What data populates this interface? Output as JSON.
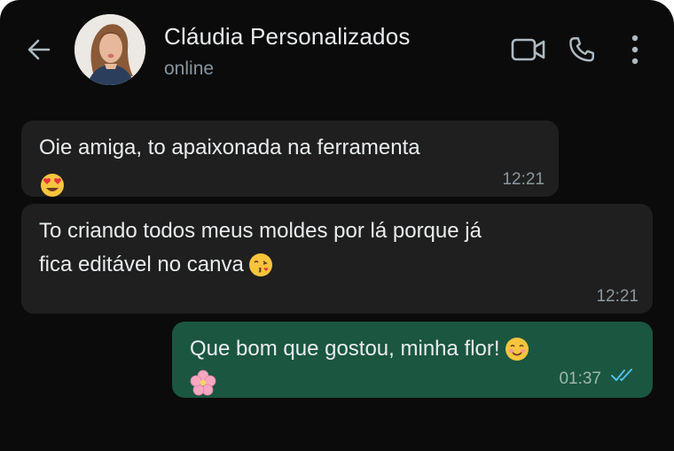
{
  "header": {
    "contact_name": "Cláudia Personalizados",
    "status": "online"
  },
  "icons": {
    "back": "arrow-left-icon",
    "video": "video-camera-icon",
    "call": "phone-icon",
    "menu": "more-vertical-icon"
  },
  "messages": [
    {
      "direction": "incoming",
      "text": "Oie amiga, to apaixonada na ferramenta",
      "emoji": "smiling-face-with-heart-eyes",
      "time": "12:21"
    },
    {
      "direction": "incoming",
      "line1": "To criando todos meus moldes por lá porque já",
      "line2": "fica editável no canva",
      "emoji": "face-blowing-a-kiss",
      "time": "12:21"
    },
    {
      "direction": "outgoing",
      "text": "Que bom que gostou, minha flor!",
      "emoji": "smiling-face-with-smiling-eyes",
      "emoji2": "cherry-blossom",
      "time": "01:37",
      "status": "read"
    }
  ],
  "colors": {
    "background": "#0b0b0b",
    "incoming_bubble": "#1f1f1f",
    "outgoing_bubble": "#1b5640",
    "read_ticks": "#53bdeb",
    "primary_text": "#e9edef",
    "secondary_text": "#8696a0"
  }
}
